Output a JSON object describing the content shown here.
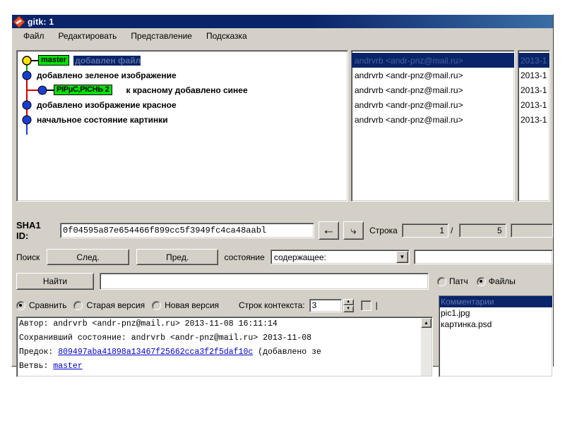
{
  "window": {
    "title": "gitk: 1",
    "logo_icon": "git-diamond-icon"
  },
  "menu": {
    "items": [
      {
        "label": "Файл"
      },
      {
        "label": "Редактировать"
      },
      {
        "label": "Представление"
      },
      {
        "label": "Подсказка"
      }
    ]
  },
  "commits": {
    "rows": [
      {
        "tag": "master",
        "message": "добавлен файл",
        "selected": true,
        "author": "andrvrb <andr-pnz@mail.ru>",
        "date": "2013-1"
      },
      {
        "tag": "",
        "message": "добавлено зеленое изображение",
        "selected": false,
        "author": "andrvrb <andr-pnz@mail.ru>",
        "date": "2013-1"
      },
      {
        "tag": "PIPµC‚PICHЬ 2",
        "message": "к красному добавлено синее",
        "selected": false,
        "author": "andrvrb <andr-pnz@mail.ru>",
        "date": "2013-1"
      },
      {
        "tag": "",
        "message": "добавлено изображение красное",
        "selected": false,
        "author": "andrvrb <andr-pnz@mail.ru>",
        "date": "2013-1"
      },
      {
        "tag": "",
        "message": "начальное состояние картинки",
        "selected": false,
        "author": "andrvrb <andr-pnz@mail.ru>",
        "date": "2013-1"
      }
    ]
  },
  "sha_row": {
    "label": "SHA1 ID:",
    "value": "0f04595a87e654466f899cc5f3949fc4ca48aabl",
    "back_icon": "arrow-left-icon",
    "forward_icon": "arrow-right-icon",
    "line_label": "Строка",
    "line_current": "1",
    "line_separator": "/",
    "line_total": "5"
  },
  "search_row": {
    "label": "Поиск",
    "next_label": "След.",
    "prev_label": "Пред.",
    "state_label": "состояние",
    "combo_value": "содержащее:",
    "combo_arrow_icon": "chevron-down-icon"
  },
  "find_row": {
    "find_label": "Найти",
    "input_value": "",
    "radio_patch": "Патч",
    "radio_files": "Файлы",
    "selected": "Файлы"
  },
  "compare_row": {
    "radio_compare": "Сравнить",
    "radio_old": "Старая версия",
    "radio_new": "Новая версия",
    "selected": "Сравнить",
    "context_label": "Строк контекста:",
    "context_value": "3",
    "spin_up_icon": "spin-up-icon",
    "spin_down_icon": "spin-down-icon",
    "pipe_char": "|"
  },
  "diff": {
    "line1_label": "Автор:",
    "line1_value": "andrvrb <andr-pnz@mail.ru>   2013-11-08 16:11:14",
    "line2_label": "Сохранивший состояние:",
    "line2_value": "andrvrb <andr-pnz@mail.ru>   2013-11-08",
    "line3_label": "Предок:",
    "line3_link": "809497aba41898a13467f25662cca3f2f5daf10c",
    "line3_tail": "(добавлено зе",
    "line4_label": "Ветвь:",
    "line4_link": "master",
    "scroll_up_icon": "scroll-up-icon"
  },
  "files": {
    "items": [
      {
        "label": "Комментарии",
        "selected": true
      },
      {
        "label": "pic1.jpg",
        "selected": false
      },
      {
        "label": "картинка.psd",
        "selected": false
      }
    ]
  },
  "colors": {
    "title_bar": "#0a246a",
    "face": "#d4d0c8",
    "tag_green": "#00e000",
    "node_blue": "#1a3fd0",
    "node_yellow": "#ffe000",
    "line_red": "#d00000",
    "line_green": "#00a000",
    "selection": "#0a246a",
    "link": "#0000cc"
  }
}
